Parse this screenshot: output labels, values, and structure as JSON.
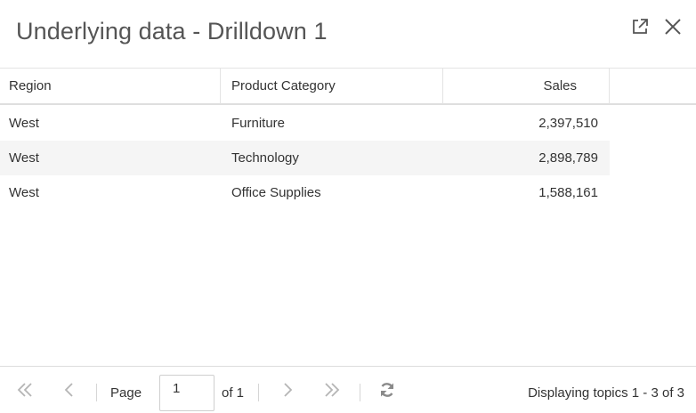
{
  "dialog": {
    "title": "Underlying data - Drilldown 1",
    "popout_icon": "external-link-icon",
    "close_icon": "close-icon"
  },
  "table": {
    "columns": [
      "Region",
      "Product Category",
      "Sales"
    ],
    "rows": [
      {
        "region": "West",
        "category": "Furniture",
        "sales": "2,397,510"
      },
      {
        "region": "West",
        "category": "Technology",
        "sales": "2,898,789"
      },
      {
        "region": "West",
        "category": "Office Supplies",
        "sales": "1,588,161"
      }
    ]
  },
  "pagination": {
    "page_label": "Page",
    "current_page": "1",
    "of_label": "of 1",
    "display_info": "Displaying topics 1 - 3 of 3",
    "icons": [
      "first-page-icon",
      "prev-page-icon",
      "next-page-icon",
      "last-page-icon",
      "refresh-icon"
    ],
    "icon_color": "#b5b5b5",
    "refresh_color": "#8a8a8a"
  }
}
